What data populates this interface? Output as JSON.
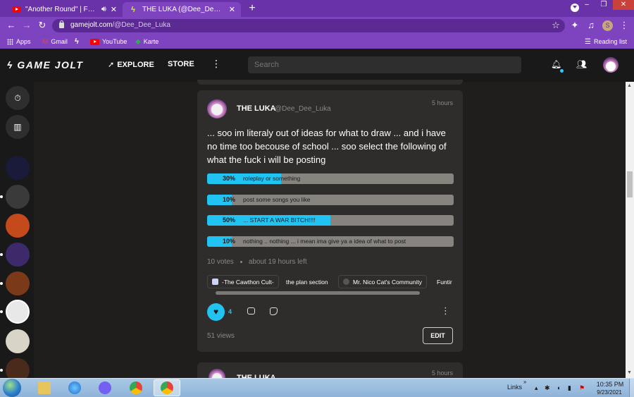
{
  "browser": {
    "tabs": [
      {
        "title": "\"Another Round\" | FNAF FUN",
        "active": false,
        "favicon": "youtube-icon",
        "audio": true
      },
      {
        "title": "THE LUKA (@Dee_Dee_Luka) - Ga",
        "active": true,
        "favicon": "gamejolt-icon"
      }
    ],
    "new_tab": "+",
    "window_controls": {
      "minimize": "–",
      "restore": "❐",
      "close": "✕"
    },
    "url_host": "gamejolt.com",
    "url_path": "/@Dee_Dee_Luka",
    "profile_initial": "S",
    "bookmarks": [
      {
        "label": "Apps",
        "icon": "apps-grid-icon"
      },
      {
        "label": "Gmail",
        "icon": "gmail-icon"
      },
      {
        "label": "",
        "icon": "gamejolt-icon"
      },
      {
        "label": "YouTube",
        "icon": "youtube-icon"
      },
      {
        "label": "Karte",
        "icon": "maps-icon"
      }
    ],
    "reading_list": "Reading list"
  },
  "gamejolt": {
    "logo": "GAME JOLT",
    "nav": {
      "explore": "EXPLORE",
      "store": "STORE"
    },
    "search_placeholder": "Search"
  },
  "post": {
    "author_name": "THE LUKA",
    "author_handle": "@Dee_Dee_Luka",
    "time": "5 hours",
    "text": "... soo im literaly out of ideas for what to draw ... and i have no time too becouse of school ... soo select the following of what the fuck i will be posting",
    "poll": [
      {
        "percent_label": "30%",
        "fraction": 0.3,
        "label": "roleplay or something"
      },
      {
        "percent_label": "10%",
        "fraction": 0.1,
        "label": "post some songs you like"
      },
      {
        "percent_label": "50%",
        "fraction": 0.5,
        "label": "... START A WAR BITCH!!!!"
      },
      {
        "percent_label": "10%",
        "fraction": 0.1,
        "label": "nothing .. nothing ... i mean ima give ya a idea of what to post"
      }
    ],
    "votes": "10 votes",
    "time_left": "about 19 hours left",
    "communities": [
      {
        "label": "-The Cawthon Cult-"
      },
      {
        "label": "the plan section"
      },
      {
        "label": "Mr. Nico Cat's Community"
      },
      {
        "label": "Funtir"
      }
    ],
    "like_count": "4",
    "views": "51 views",
    "edit_label": "EDIT"
  },
  "next_post": {
    "author_name": "THE LUKA",
    "author_handle": "@Dee_Dee_Luka",
    "time": "5 hours"
  },
  "taskbar": {
    "links": "Links",
    "chevrons": "»",
    "time": "10:35 PM",
    "date": "9/23/2021"
  },
  "colors": {
    "browser_purple": "#7e44bf",
    "gamejolt_bg": "#191919",
    "card_bg": "#2e2d2b",
    "poll_accent": "#21c3f3"
  }
}
